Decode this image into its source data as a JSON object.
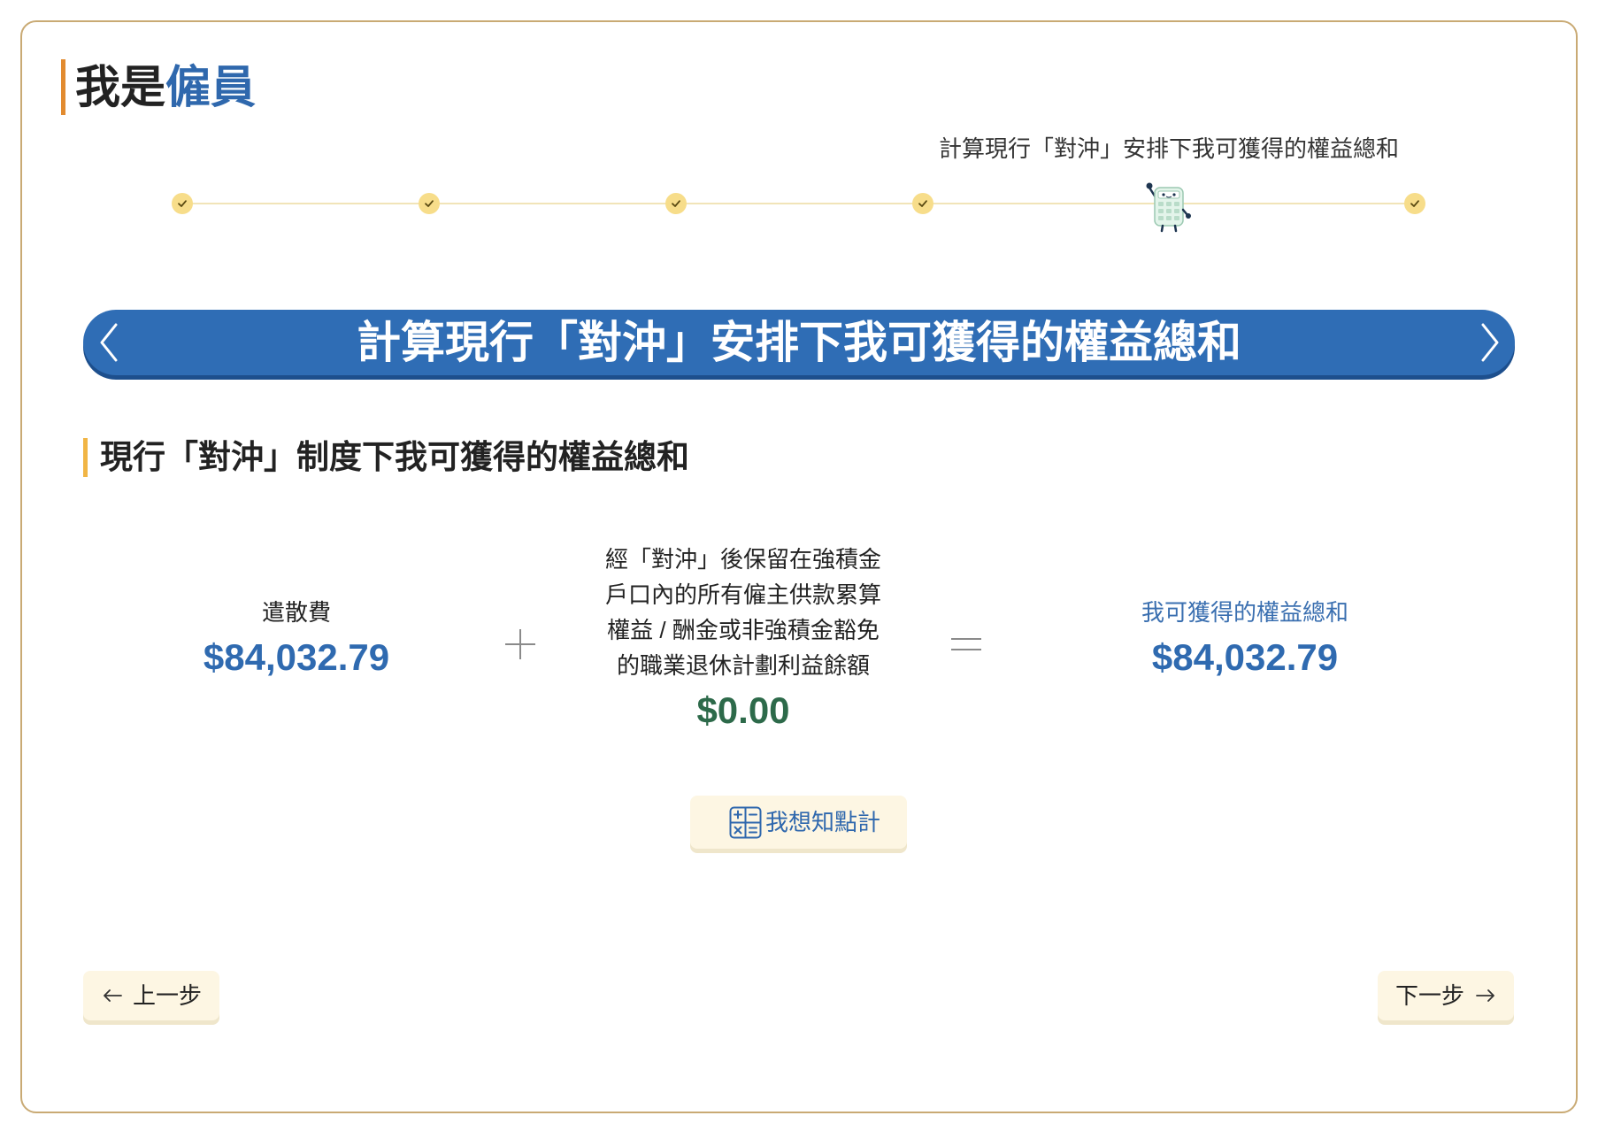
{
  "header": {
    "title_plain": "我是",
    "title_highlight": "僱員"
  },
  "stepper": {
    "current_step_label": "計算現行「對沖」安排下我可獲得的權益總和",
    "steps": [
      "check-icon",
      "check-icon",
      "check-icon",
      "check-icon",
      "calculator-mascot-icon",
      "check-icon"
    ]
  },
  "banner": {
    "title": "計算現行「對沖」安排下我可獲得的權益總和",
    "prev_icon": "chevron-left-icon",
    "next_icon": "chevron-right-icon"
  },
  "section": {
    "heading": "現行「對沖」制度下我可獲得的權益總和"
  },
  "equation": {
    "severance": {
      "label": "遣散費",
      "amount": "$84,032.79"
    },
    "operator_1": "plus-icon",
    "retained": {
      "label_lines": [
        "經「對沖」後保留在強積金",
        "戶口內的所有僱主供款累算",
        "權益 / 酬金或非強積金豁免",
        "的職業退休計劃利益餘額"
      ],
      "amount": "$0.00"
    },
    "operator_2": "equals-icon",
    "total": {
      "label": "我可獲得的權益總和",
      "amount": "$84,032.79"
    }
  },
  "explain_button": {
    "label": "我想知點計",
    "icon": "calculator-icon"
  },
  "navigation": {
    "prev_label": "上一步",
    "prev_icon": "arrow-left-icon",
    "next_label": "下一步",
    "next_icon": "arrow-right-icon"
  },
  "colors": {
    "accent_blue": "#2f6db5",
    "title_blue": "#2f68ad",
    "amount_green": "#2d6a4a",
    "title_bar_orange": "#e28b30",
    "section_bar_orange": "#f1b545",
    "step_dot_yellow": "#f7dd8a",
    "card_border": "#c9aa74",
    "button_bg": "#fdf6e3"
  }
}
